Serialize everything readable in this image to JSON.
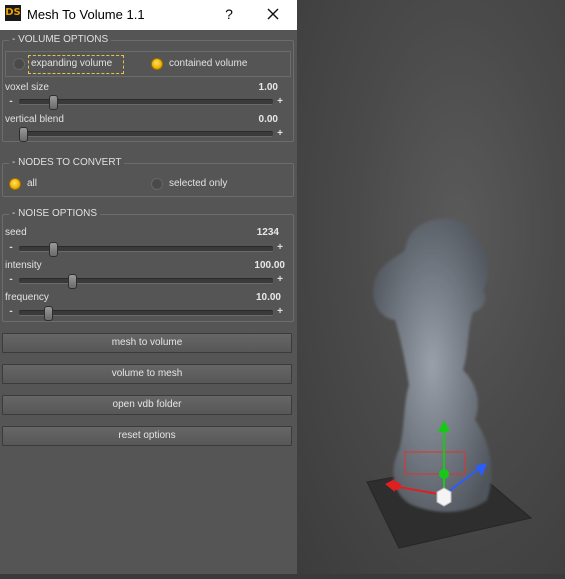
{
  "window": {
    "title": "Mesh To Volume 1.1",
    "logo_text": "DS",
    "help_label": "?"
  },
  "volume_options": {
    "legend": "- VOLUME OPTIONS",
    "options": [
      {
        "label": "expanding volume",
        "selected": false,
        "focused": true
      },
      {
        "label": "contained volume",
        "selected": true,
        "focused": false
      }
    ],
    "sliders": [
      {
        "label": "voxel size",
        "value": "1.00",
        "level": 0.12
      },
      {
        "label": "vertical blend",
        "value": "0.00",
        "level": 0.0
      }
    ]
  },
  "nodes_to_convert": {
    "legend": "- NODES TO CONVERT",
    "options": [
      {
        "label": "all",
        "selected": true
      },
      {
        "label": "selected only",
        "selected": false
      }
    ]
  },
  "noise_options": {
    "legend": "- NOISE OPTIONS",
    "sliders": [
      {
        "label": "seed",
        "value": "1234",
        "level": 0.12
      },
      {
        "label": "intensity",
        "value": "100.00",
        "level": 0.2
      },
      {
        "label": "frequency",
        "value": "10.00",
        "level": 0.1
      }
    ]
  },
  "slider_minus": "-",
  "slider_plus": "+",
  "buttons": {
    "mesh_to_volume": "mesh to volume",
    "volume_to_mesh": "volume to mesh",
    "open_vdb_folder": "open vdb folder",
    "reset_options": "reset options"
  },
  "colors": {
    "accent": "#f1b600",
    "panel": "#555555",
    "titlebar": "#ffffff",
    "focus": "#e6c24a"
  }
}
